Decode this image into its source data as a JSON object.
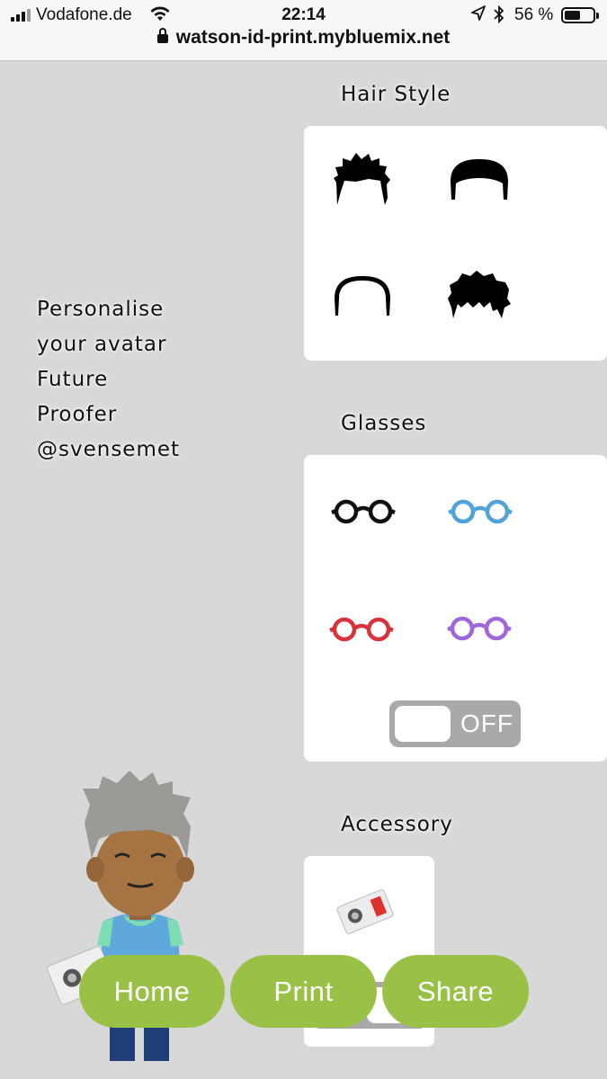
{
  "status_bar": {
    "carrier": "Vodafone.de",
    "time": "22:14",
    "battery_percent": "56 %",
    "battery_level": 0.56
  },
  "browser": {
    "url": "watson-id-print.mybluemix.net"
  },
  "intro": {
    "lines": [
      "Personalise",
      "your avatar",
      "Future",
      "Proofer",
      "@svensemet"
    ]
  },
  "hair_style": {
    "title": "Hair Style",
    "options": [
      "spiky-hair-icon",
      "flat-top-hair-icon",
      "bald-outline-hair-icon",
      "swept-hair-icon"
    ]
  },
  "glasses": {
    "title": "Glasses",
    "options": [
      {
        "icon": "black-glasses-icon",
        "color": "#111111"
      },
      {
        "icon": "blue-glasses-icon",
        "color": "#4fa3d9"
      },
      {
        "icon": "red-glasses-icon",
        "color": "#d9323a"
      },
      {
        "icon": "purple-glasses-icon",
        "color": "#a067d8"
      }
    ],
    "toggle_label": "OFF",
    "toggle_on": false
  },
  "accessory": {
    "title": "Accessory",
    "options": [
      "id-badge-icon"
    ]
  },
  "colors": {
    "button_green": "#99c146",
    "background": "#d8d8d8",
    "toggle_grey": "#a9a9a9"
  },
  "actions": {
    "home": "Home",
    "print": "Print",
    "share": "Share"
  }
}
